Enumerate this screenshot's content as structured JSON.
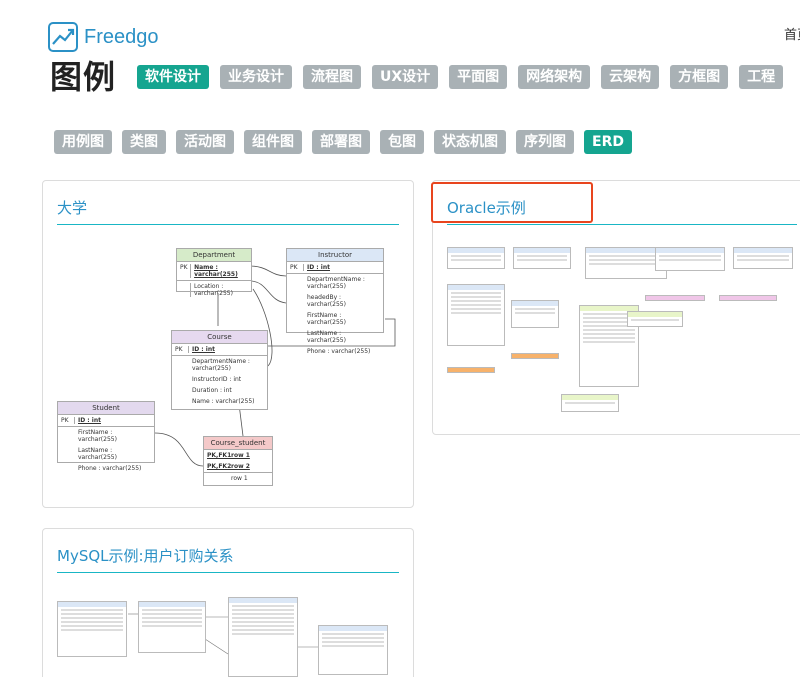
{
  "header": {
    "brand": "Freedgo",
    "top_link": "首页",
    "page_title": "图例"
  },
  "categories": [
    {
      "label": "软件设计",
      "active": true
    },
    {
      "label": "业务设计",
      "active": false
    },
    {
      "label": "流程图",
      "active": false
    },
    {
      "label": "UX设计",
      "active": false
    },
    {
      "label": "平面图",
      "active": false
    },
    {
      "label": "网络架构",
      "active": false
    },
    {
      "label": "云架构",
      "active": false
    },
    {
      "label": "方框图",
      "active": false
    },
    {
      "label": "工程",
      "active": false
    }
  ],
  "subcategories": [
    {
      "label": "用例图",
      "active": false
    },
    {
      "label": "类图",
      "active": false
    },
    {
      "label": "活动图",
      "active": false
    },
    {
      "label": "组件图",
      "active": false
    },
    {
      "label": "部署图",
      "active": false
    },
    {
      "label": "包图",
      "active": false
    },
    {
      "label": "状态机图",
      "active": false
    },
    {
      "label": "序列图",
      "active": false
    },
    {
      "label": "ERD",
      "active": true
    }
  ],
  "cards": [
    {
      "title": "大学"
    },
    {
      "title": "Oracle示例"
    },
    {
      "title": "MySQL示例:用户订购关系"
    }
  ],
  "university_erd": {
    "department": {
      "name": "Department",
      "pk": "PK",
      "fields": [
        "Name : varchar(255)",
        "Location : varchar(255)"
      ]
    },
    "instructor": {
      "name": "Instructor",
      "pk": "PK",
      "fields": [
        "ID : int",
        "DepartmentName : varchar(255)",
        "headedBy : varchar(255)",
        "FirstName : varchar(255)",
        "LastName : varchar(255)",
        "Phone : varchar(255)"
      ]
    },
    "course": {
      "name": "Course",
      "pk": "PK",
      "fields": [
        "ID : int",
        "DepartmentName : varchar(255)",
        "InstructorID : int",
        "Duration : int",
        "Name : varchar(255)"
      ]
    },
    "student": {
      "name": "Student",
      "pk": "PK",
      "fields": [
        "ID : int",
        "FirstName : varchar(255)",
        "LastName : varchar(255)",
        "Phone : varchar(255)"
      ]
    },
    "course_student": {
      "name": "Course_student",
      "keys": [
        "PK,FK1",
        "PK,FK2"
      ],
      "fields": [
        "row 1",
        "row 2",
        "row 1"
      ]
    }
  },
  "colors": {
    "accent": "#15a590",
    "tag_inactive": "#a9b1b5",
    "link_blue": "#2b91c6",
    "rule_teal": "#19b6c5",
    "highlight": "#e8451e",
    "department_header": "#d6ebc9",
    "instructor_header": "#dbe7f6",
    "course_header": "#e6d9ef",
    "student_header": "#e3d9ee",
    "course_student_header": "#f4c9c9"
  }
}
